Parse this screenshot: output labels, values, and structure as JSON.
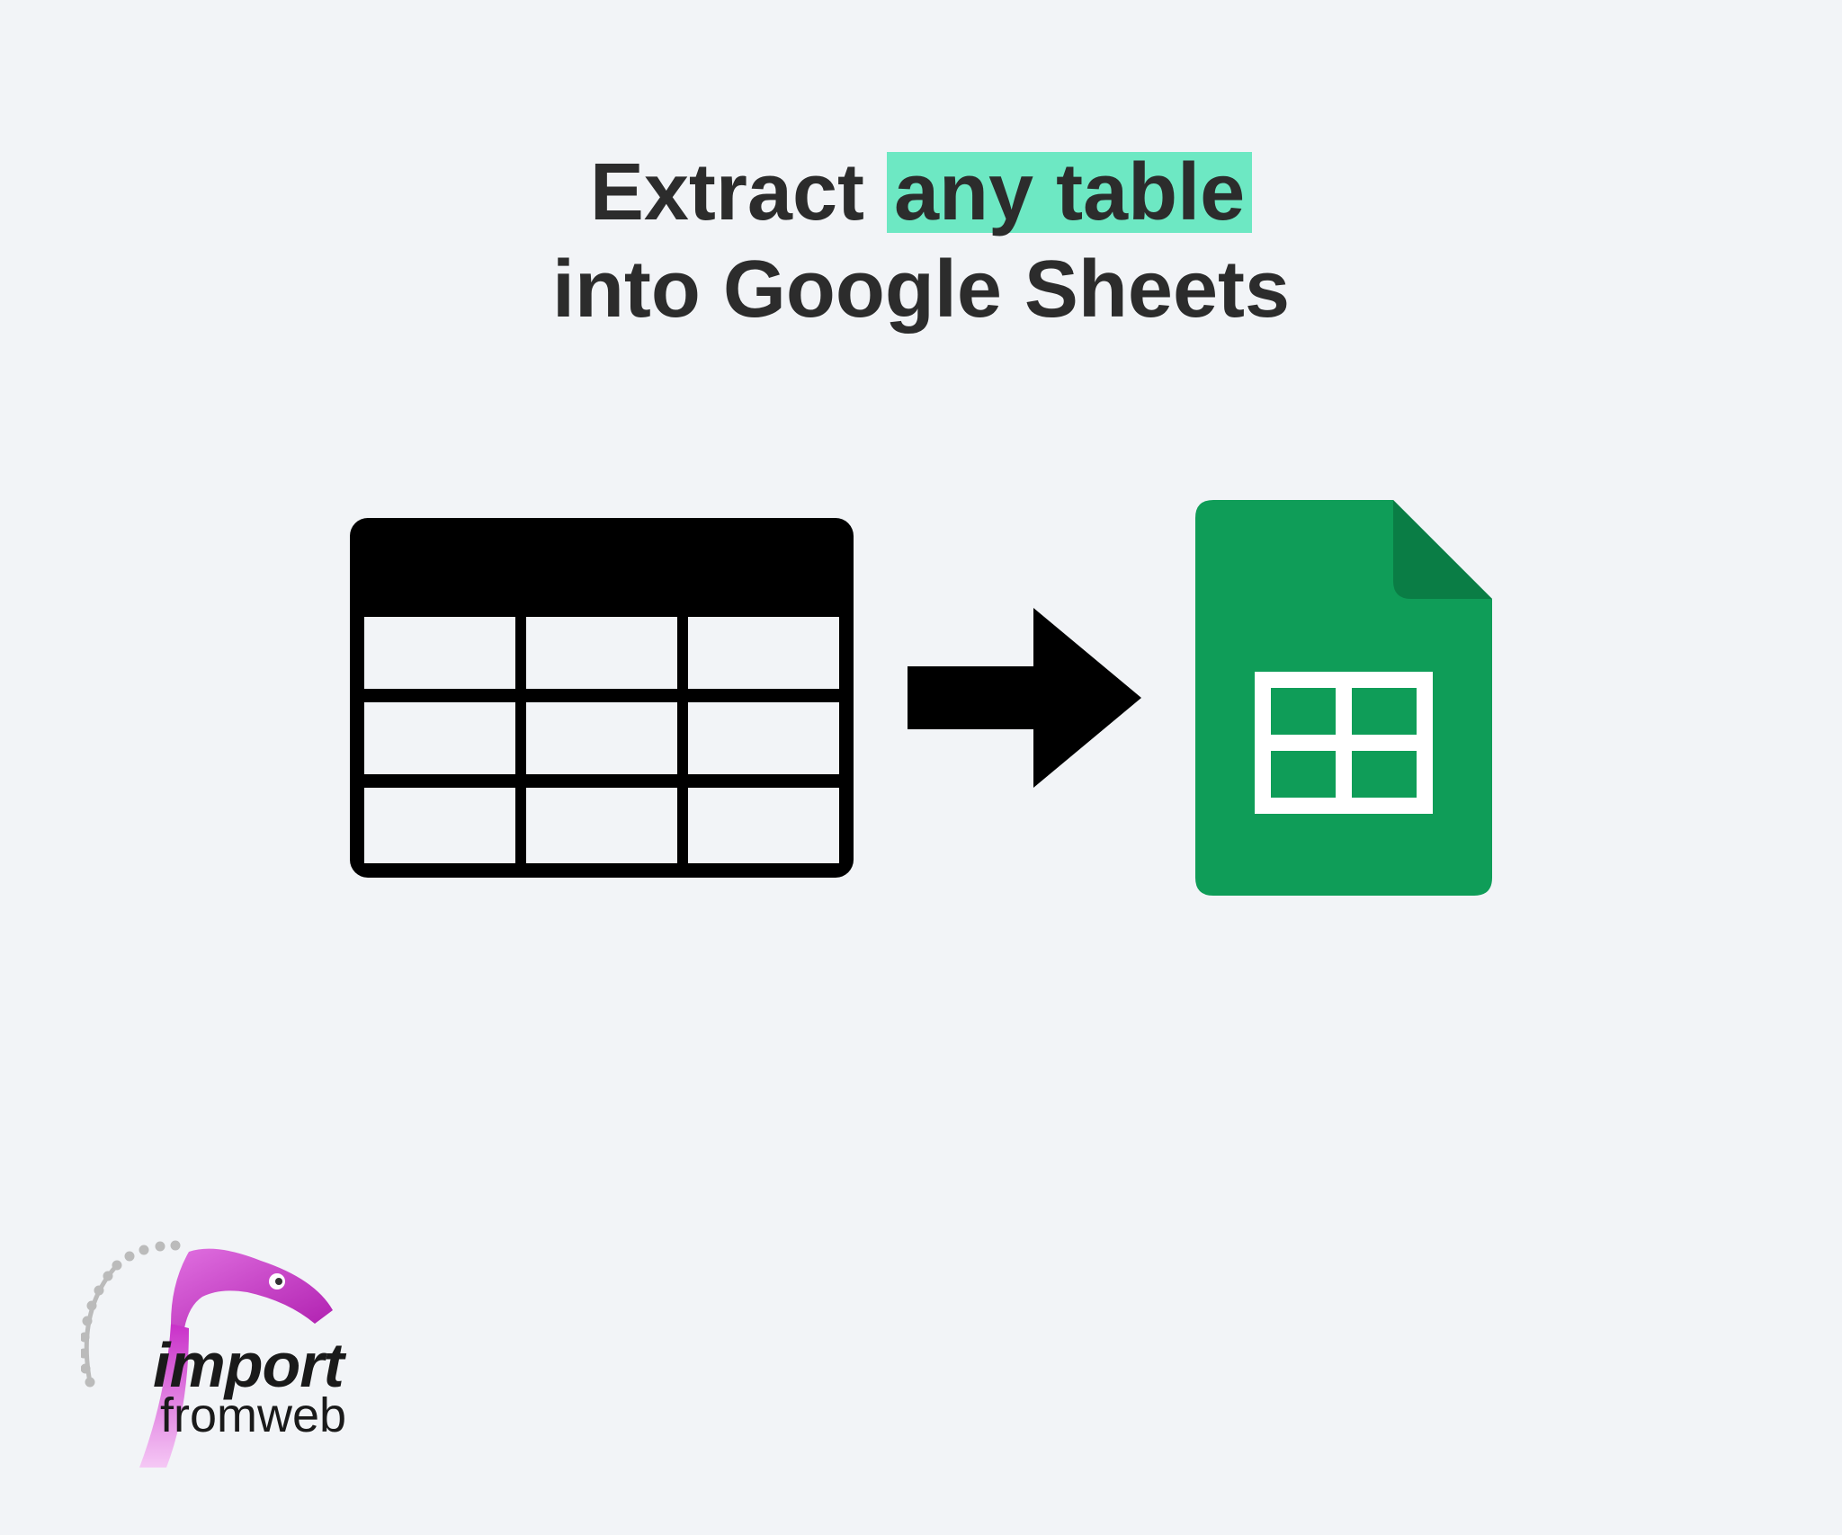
{
  "headline": {
    "prefix": "Extract",
    "highlight": "any table",
    "line2": "into Google Sheets"
  },
  "logo": {
    "line1": "import",
    "line2": "fromweb"
  },
  "colors": {
    "highlight": "#6de8c3",
    "sheets_green": "#0f9d58",
    "sheets_fold": "#0a7d45",
    "logo_magenta": "#c930c9",
    "text_dark": "#2c2c2c"
  }
}
